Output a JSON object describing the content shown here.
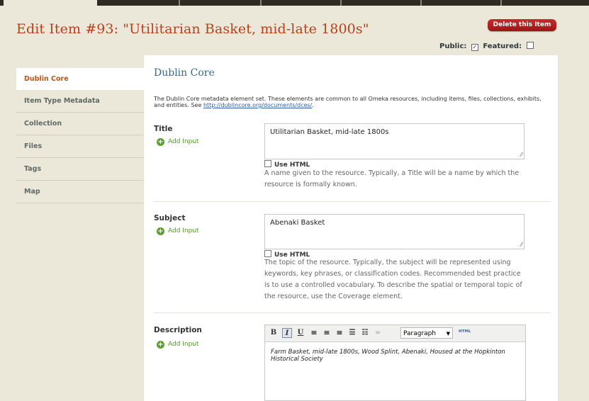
{
  "page": {
    "title": "Edit Item #93: \"Utilitarian Basket, mid-late 1800s\"",
    "delete_button": "Delete this Item",
    "public_label": "Public:",
    "featured_label": "Featured:",
    "public_checked": true,
    "featured_checked": false
  },
  "sidebar": {
    "items": [
      {
        "label": "Dublin Core",
        "active": true
      },
      {
        "label": "Item Type Metadata",
        "active": false
      },
      {
        "label": "Collection",
        "active": false
      },
      {
        "label": "Files",
        "active": false
      },
      {
        "label": "Tags",
        "active": false
      },
      {
        "label": "Map",
        "active": false
      }
    ]
  },
  "main": {
    "heading": "Dublin Core",
    "intro_text": "The Dublin Core metadata element set. These elements are common to all Omeka resources, including items, files, collections, exhibits, and entities. See ",
    "intro_link": "http://dublincore.org/documents/dces/",
    "intro_end": ".",
    "add_input_label": "Add Input",
    "use_html_label": "Use HTML",
    "fields": {
      "title": {
        "label": "Title",
        "value": "Utilitarian Basket, mid-late 1800s",
        "help": "A name given to the resource. Typically, a Title will be a name by which the resource is formally known."
      },
      "subject": {
        "label": "Subject",
        "value": "Abenaki Basket",
        "help": "The topic of the resource. Typically, the subject will be represented using keywords, key phrases, or classification codes. Recommended best practice is to use a controlled vocabulary. To describe the spatial or temporal topic of the resource, use the Coverage element."
      },
      "description": {
        "label": "Description",
        "value": "Farm Basket, mid-late 1800s, Wood Splint, Abenaki, Housed at the Hopkinton Historical Society"
      }
    },
    "editor": {
      "bold": "B",
      "italic": "I",
      "underline": "U",
      "format_select": "Paragraph",
      "html_button": "HTML"
    }
  },
  "colors": {
    "background": "#ebe8d9",
    "title": "#b8411a",
    "delete_button": "#b71f1f",
    "active_tab": "#c0521c",
    "add_input": "#4f9d1f",
    "heading": "#3c6686"
  }
}
